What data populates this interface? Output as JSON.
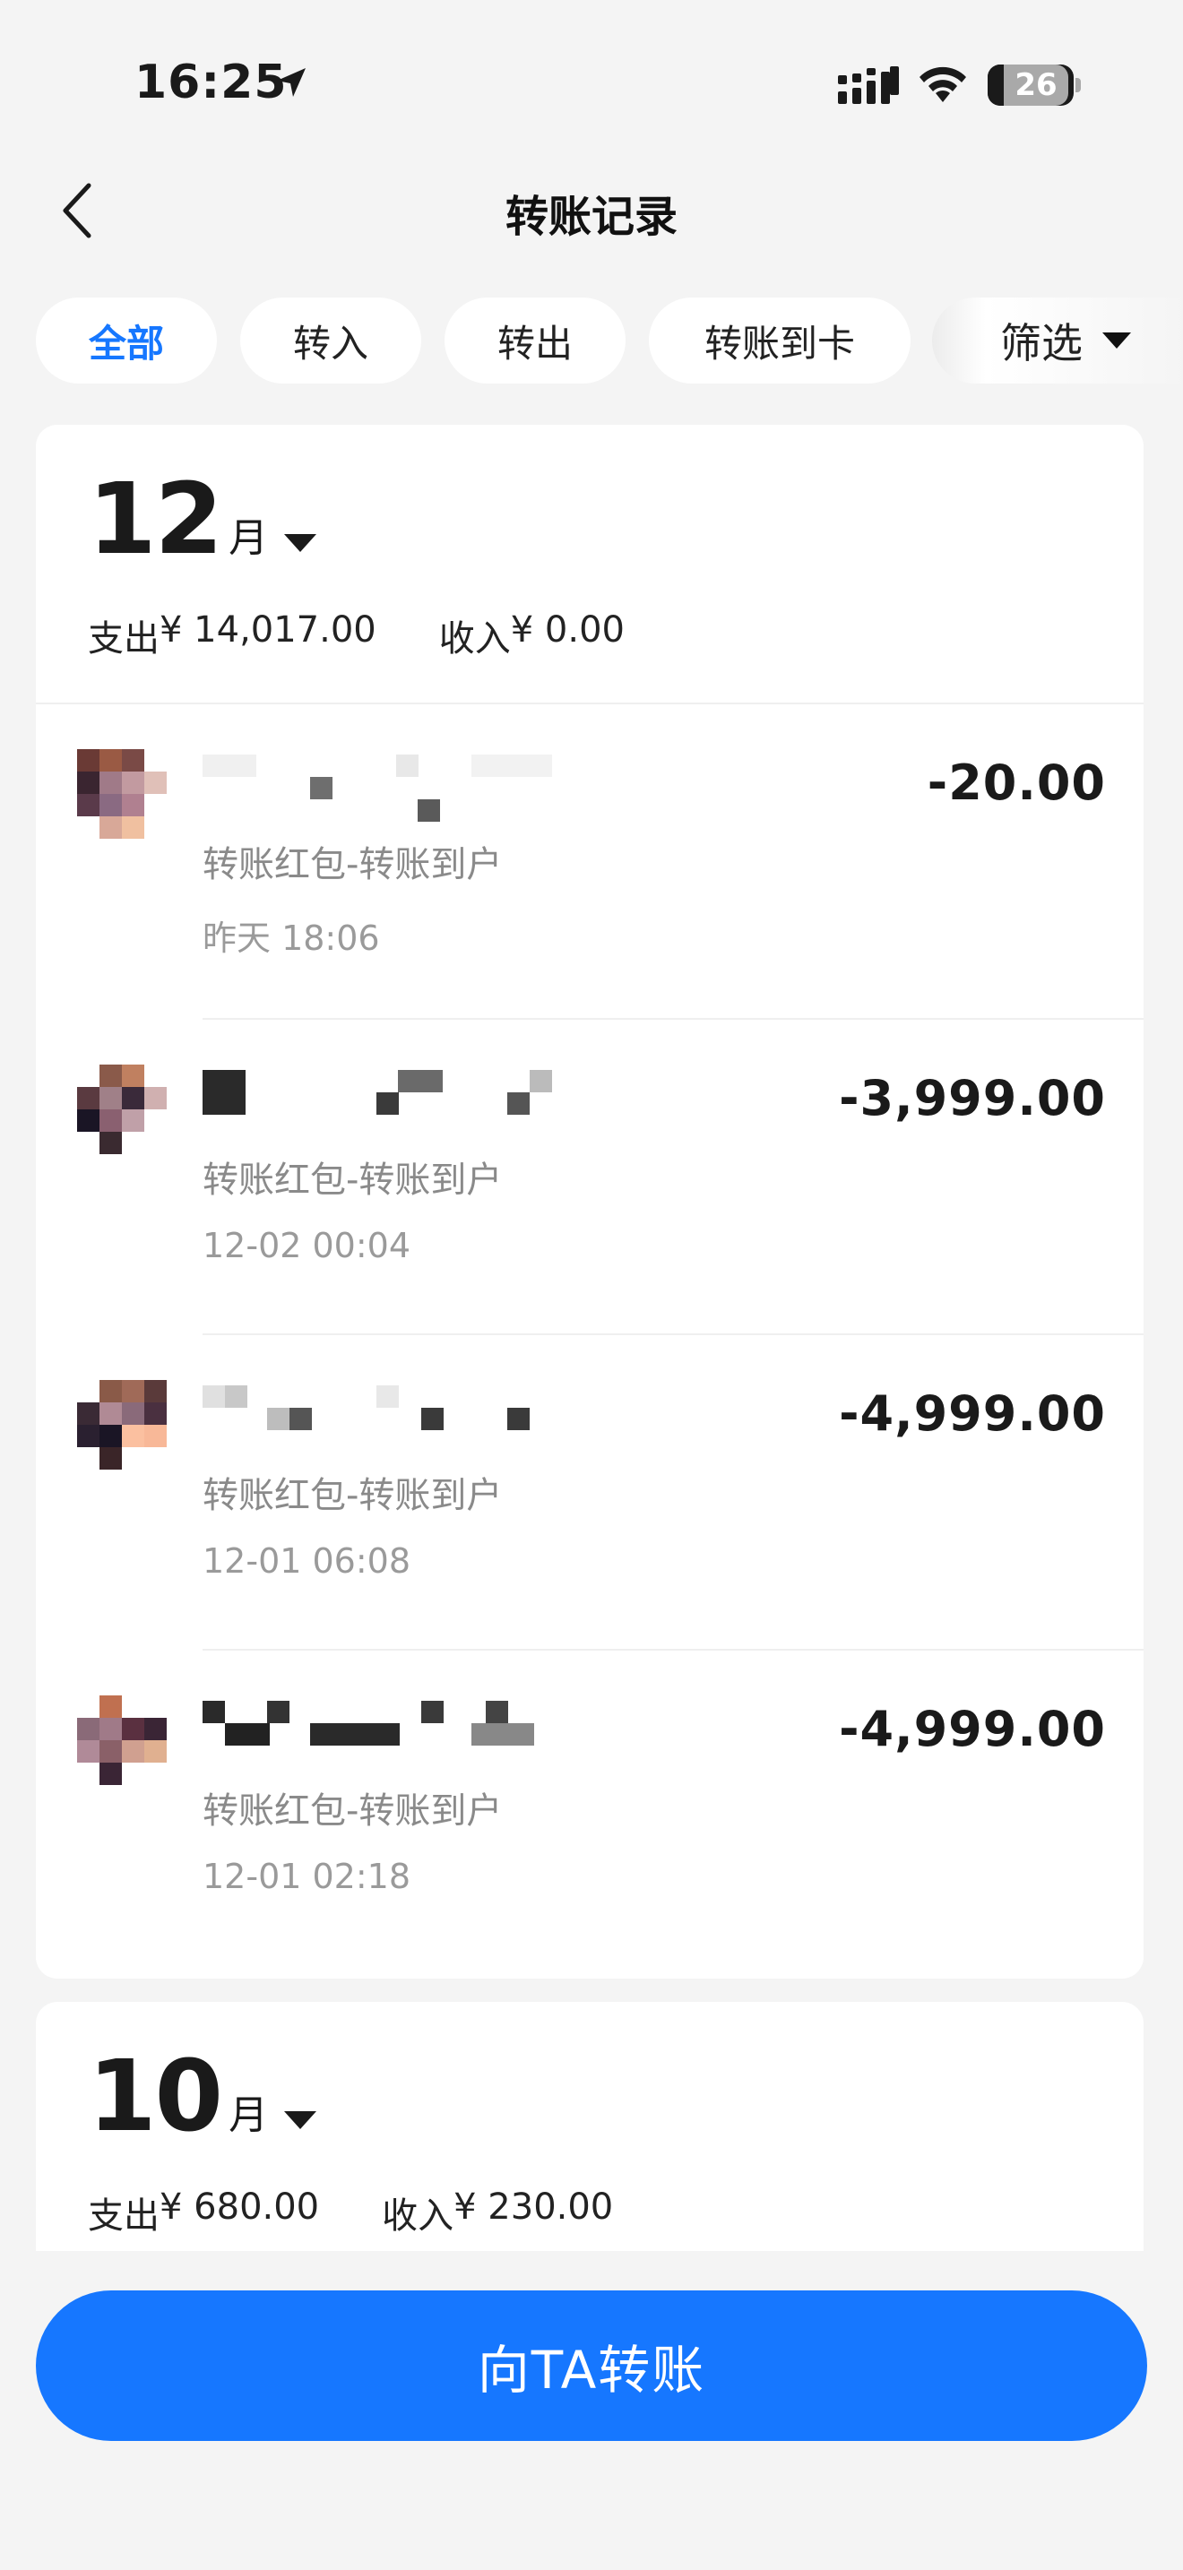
{
  "status_bar": {
    "time": "16:25",
    "battery": "26"
  },
  "nav": {
    "title": "转账记录"
  },
  "filters": {
    "chips": [
      "全部",
      "转入",
      "转出",
      "转账到卡"
    ],
    "filter_label": "筛选"
  },
  "months": [
    {
      "month": "12",
      "unit": "月",
      "expense_label": "支出",
      "expense": "¥ 14,017.00",
      "income_label": "收入",
      "income": "¥ 0.00",
      "transactions": [
        {
          "desc": "转账红包-转账到户",
          "time": "昨天 18:06",
          "amount": "-20.00"
        },
        {
          "desc": "转账红包-转账到户",
          "time": "12-02 00:04",
          "amount": "-3,999.00"
        },
        {
          "desc": "转账红包-转账到户",
          "time": "12-01 06:08",
          "amount": "-4,999.00"
        },
        {
          "desc": "转账红包-转账到户",
          "time": "12-01 02:18",
          "amount": "-4,999.00"
        }
      ]
    },
    {
      "month": "10",
      "unit": "月",
      "expense_label": "支出",
      "expense": "¥ 680.00",
      "income_label": "收入",
      "income": "¥ 230.00"
    }
  ],
  "action": {
    "label": "向TA转账"
  },
  "colors": {
    "accent": "#1677ff",
    "background": "#f4f4f4",
    "card": "#ffffff"
  }
}
